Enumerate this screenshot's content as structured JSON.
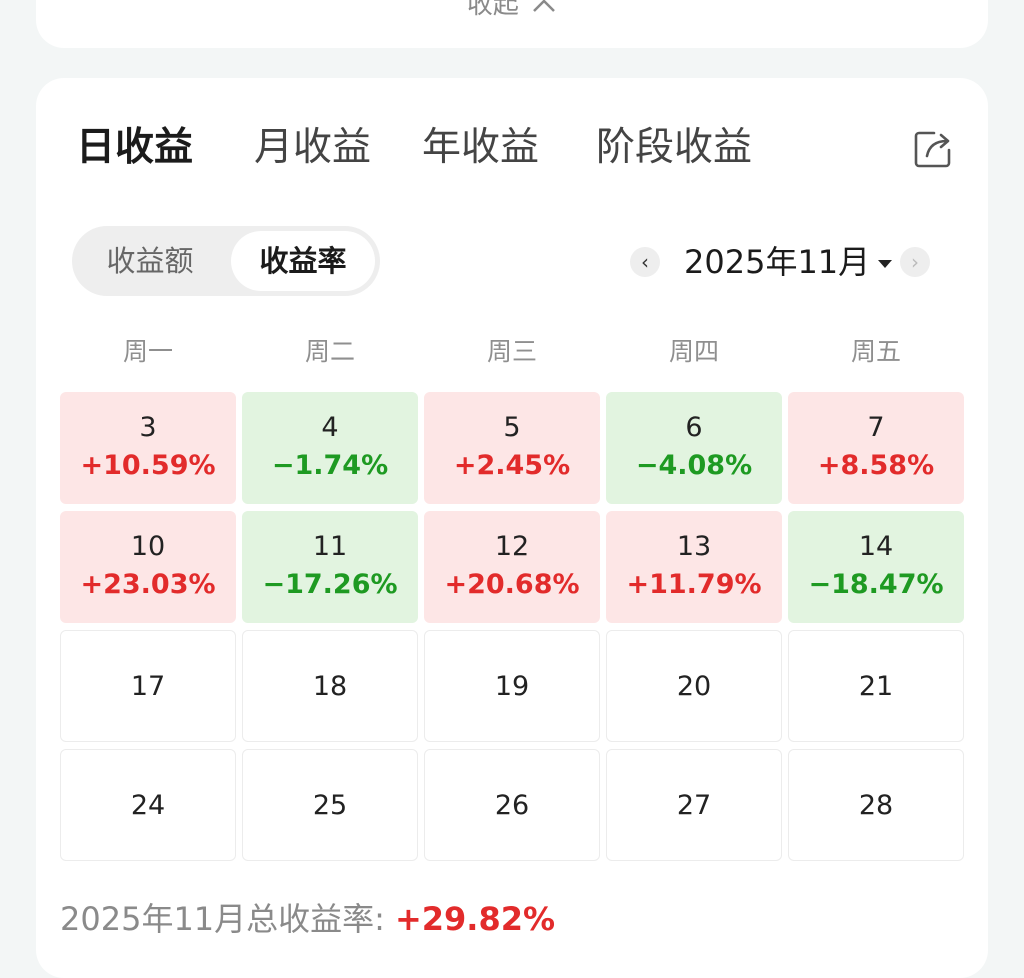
{
  "top": {
    "collapse_label": "收起"
  },
  "tabs": [
    {
      "label": "日收益",
      "active": true
    },
    {
      "label": "月收益",
      "active": false
    },
    {
      "label": "年收益",
      "active": false
    },
    {
      "label": "阶段收益",
      "active": false
    }
  ],
  "share": {
    "icon": "share-icon"
  },
  "segment": [
    {
      "label": "收益额",
      "active": false
    },
    {
      "label": "收益率",
      "active": true
    }
  ],
  "month_nav": {
    "prev": "‹",
    "label": "2025年11月",
    "next": "›"
  },
  "weekdays": [
    "周一",
    "周二",
    "周三",
    "周四",
    "周五"
  ],
  "calendar": {
    "rows": [
      [
        {
          "day": "3",
          "value": "+10.59%",
          "trend": "up"
        },
        {
          "day": "4",
          "value": "−1.74%",
          "trend": "down"
        },
        {
          "day": "5",
          "value": "+2.45%",
          "trend": "up"
        },
        {
          "day": "6",
          "value": "−4.08%",
          "trend": "down"
        },
        {
          "day": "7",
          "value": "+8.58%",
          "trend": "up"
        }
      ],
      [
        {
          "day": "10",
          "value": "+23.03%",
          "trend": "up"
        },
        {
          "day": "11",
          "value": "−17.26%",
          "trend": "down"
        },
        {
          "day": "12",
          "value": "+20.68%",
          "trend": "up"
        },
        {
          "day": "13",
          "value": "+11.79%",
          "trend": "up"
        },
        {
          "day": "14",
          "value": "−18.47%",
          "trend": "down"
        }
      ],
      [
        {
          "day": "17",
          "value": "",
          "trend": "none"
        },
        {
          "day": "18",
          "value": "",
          "trend": "none"
        },
        {
          "day": "19",
          "value": "",
          "trend": "none"
        },
        {
          "day": "20",
          "value": "",
          "trend": "none"
        },
        {
          "day": "21",
          "value": "",
          "trend": "none"
        }
      ],
      [
        {
          "day": "24",
          "value": "",
          "trend": "none"
        },
        {
          "day": "25",
          "value": "",
          "trend": "none"
        },
        {
          "day": "26",
          "value": "",
          "trend": "none"
        },
        {
          "day": "27",
          "value": "",
          "trend": "none"
        },
        {
          "day": "28",
          "value": "",
          "trend": "none"
        }
      ]
    ]
  },
  "summary": {
    "label": "2025年11月总收益率:",
    "value": "+29.82%"
  },
  "colors": {
    "accent": "#f04b0f",
    "up": "#e22b2b",
    "down": "#1e9a22",
    "up_bg": "#fde6e6",
    "down_bg": "#e2f4e0"
  }
}
